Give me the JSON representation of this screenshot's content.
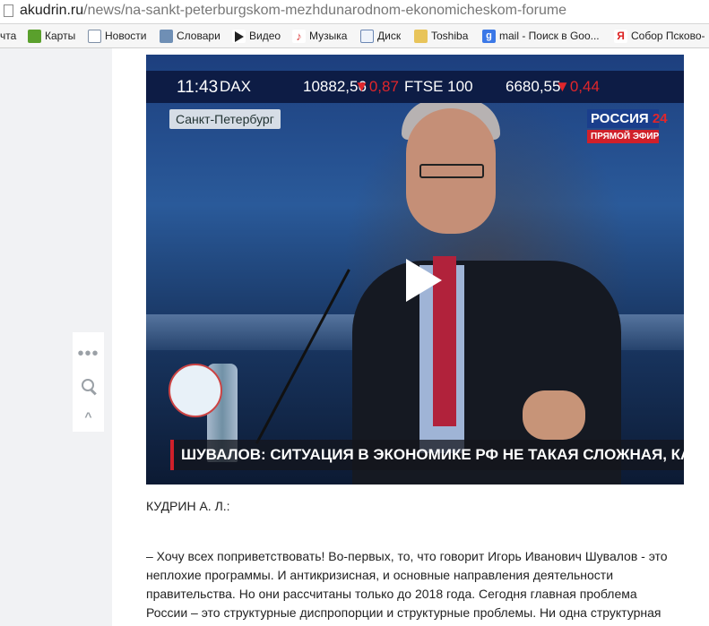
{
  "browser": {
    "url_domain": "akudrin.ru",
    "url_path": "/news/na-sankt-peterburgskom-mezhdunarodnom-ekonomicheskom-forume",
    "bookmarks": [
      {
        "label": "чта",
        "icon": "mail-icon"
      },
      {
        "label": "Карты",
        "icon": "maps-icon"
      },
      {
        "label": "Новости",
        "icon": "news-icon"
      },
      {
        "label": "Словари",
        "icon": "dictionary-icon"
      },
      {
        "label": "Видео",
        "icon": "video-icon"
      },
      {
        "label": "Музыка",
        "icon": "music-icon"
      },
      {
        "label": "Диск",
        "icon": "disk-icon"
      },
      {
        "label": "Toshiba",
        "icon": "folder-icon"
      },
      {
        "label": "mail - Поиск в Goo...",
        "icon": "google-icon"
      },
      {
        "label": "Собор Псково-",
        "icon": "yandex-icon"
      }
    ]
  },
  "video": {
    "ticker": {
      "time": "11:43",
      "index1": "DAX",
      "value1": "10882,56",
      "change1": "▼0,87",
      "index2": "FTSE 100",
      "value2": "6680,55",
      "change2": "▼0,44"
    },
    "city_label": "Санкт-Петербург",
    "channel_name": "РОССИЯ",
    "channel_number": "24",
    "live_label": "ПРЯМОЙ ЭФИР",
    "headline": "ШУВАЛОВ: СИТУАЦИЯ В ЭКОНОМИКЕ РФ НЕ ТАКАЯ СЛОЖНАЯ, КАК ОЖИДАЛИ"
  },
  "sidebar_widget": {
    "more": "•••",
    "up": "^"
  },
  "article": {
    "speaker": "КУДРИН А. Л.:",
    "paragraph": "– Хочу всех поприветствовать! Во-первых, то, что говорит Игорь Иванович Шувалов - это неплохие программы. И антикризисная, и основные направления деятельности правительства. Но они рассчитаны только до 2018 года. Сегодня главная проблема России – это структурные диспропорции и структурные проблемы. Ни одна структурная"
  },
  "colors": {
    "accent_red": "#d0202a",
    "channel_blue": "#1a3e8c",
    "ticker_bg": "#0d1c45"
  }
}
